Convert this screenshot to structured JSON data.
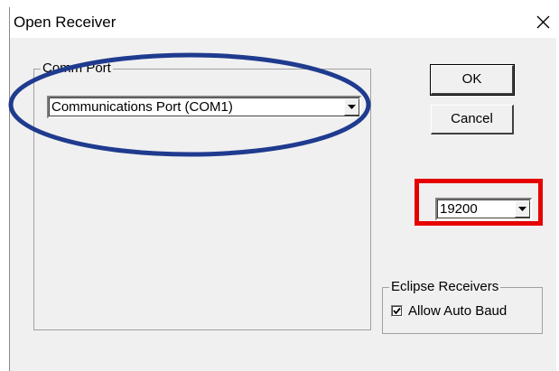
{
  "dialog": {
    "title": "Open Receiver",
    "close_icon": "close-x-icon"
  },
  "comm_port": {
    "group_label": "Comm Port",
    "selected": "Communications Port (COM1)"
  },
  "buttons": {
    "ok": "OK",
    "cancel": "Cancel"
  },
  "baud": {
    "selected": "19200"
  },
  "eclipse": {
    "group_label": "Eclipse Receivers",
    "auto_baud_label": "Allow Auto Baud",
    "auto_baud_checked": true
  },
  "annotations": {
    "ellipse_color": "#1f3b8f",
    "rect_color": "#e60000"
  }
}
